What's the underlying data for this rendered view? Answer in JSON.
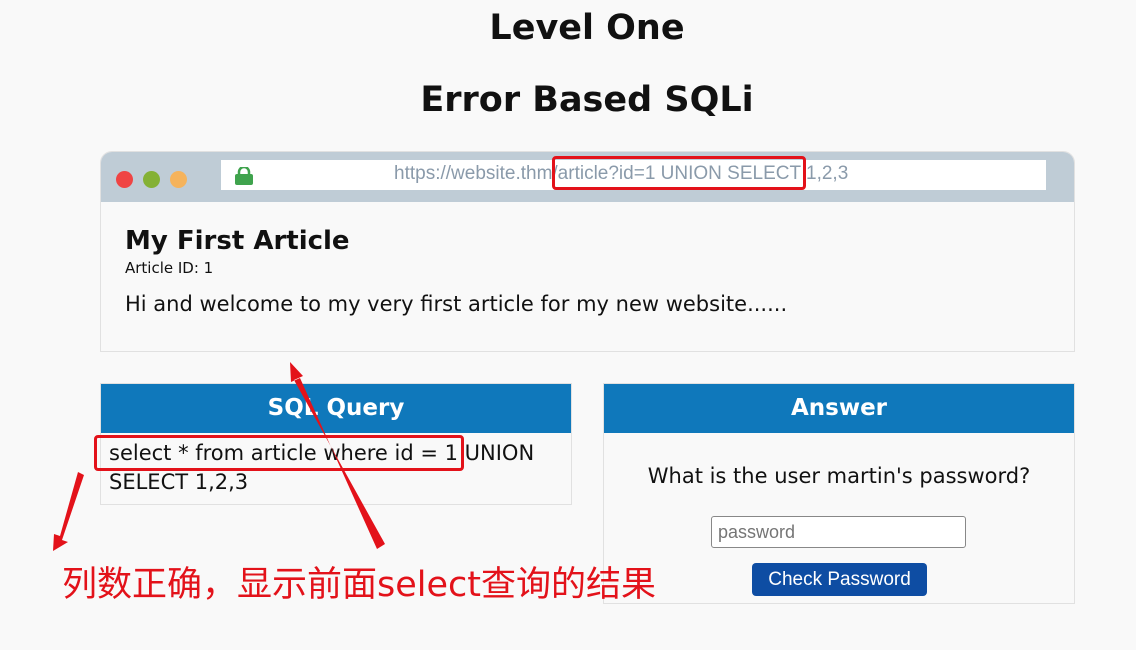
{
  "page": {
    "title": "Level One",
    "subtitle": "Error Based SQLi"
  },
  "browser": {
    "url": "https://website.thm/article?id=1 UNION SELECT 1,2,3",
    "icons": [
      "close-dot",
      "minimize-dot",
      "maximize-dot",
      "lock-icon"
    ]
  },
  "article": {
    "title": "My First Article",
    "id_label": "Article ID: 1",
    "body": "Hi and welcome to my very first article for my new website......"
  },
  "sql_panel": {
    "header": "SQL Query",
    "query": "select * from article where id = 1 UNION SELECT 1,2,3"
  },
  "answer_panel": {
    "header": "Answer",
    "question": "What is the user martin's password?",
    "password_placeholder": "password",
    "password_value": "",
    "button_label": "Check Password"
  },
  "annotation": {
    "text": "列数正确，显示前面select查询的结果",
    "color": "#e3121a"
  },
  "colors": {
    "panel_header": "#0f78bb",
    "button": "#0e4da3",
    "browser_bar": "#bfccd6",
    "highlight": "#e3121a"
  }
}
